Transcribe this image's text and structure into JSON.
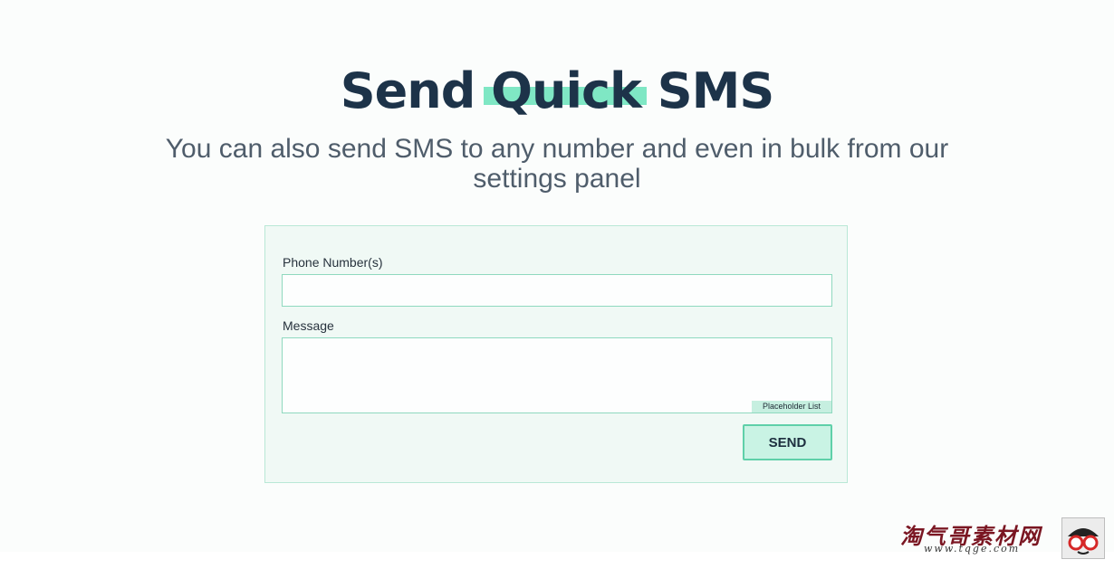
{
  "hero": {
    "title_prefix": "Send ",
    "title_highlight": "Quick",
    "title_suffix": " SMS",
    "subtitle": "You can also send SMS to any number and even in bulk from our settings panel"
  },
  "form": {
    "phone_label": "Phone Number(s)",
    "phone_value": "",
    "message_label": "Message",
    "message_value": "",
    "placeholder_list_label": "Placeholder List",
    "send_label": "SEND"
  },
  "watermark": {
    "brand": "淘气哥素材网",
    "url": "www.tqge.com"
  },
  "colors": {
    "title": "#1d3349",
    "highlight": "#7fe7c4",
    "subtitle": "#4f5d6b",
    "card_bg": "#f0f9f5",
    "card_border": "#b9e8d6",
    "input_border": "#8fd9bf",
    "send_bg": "#c9f3e4",
    "send_border": "#5fd0a9"
  }
}
